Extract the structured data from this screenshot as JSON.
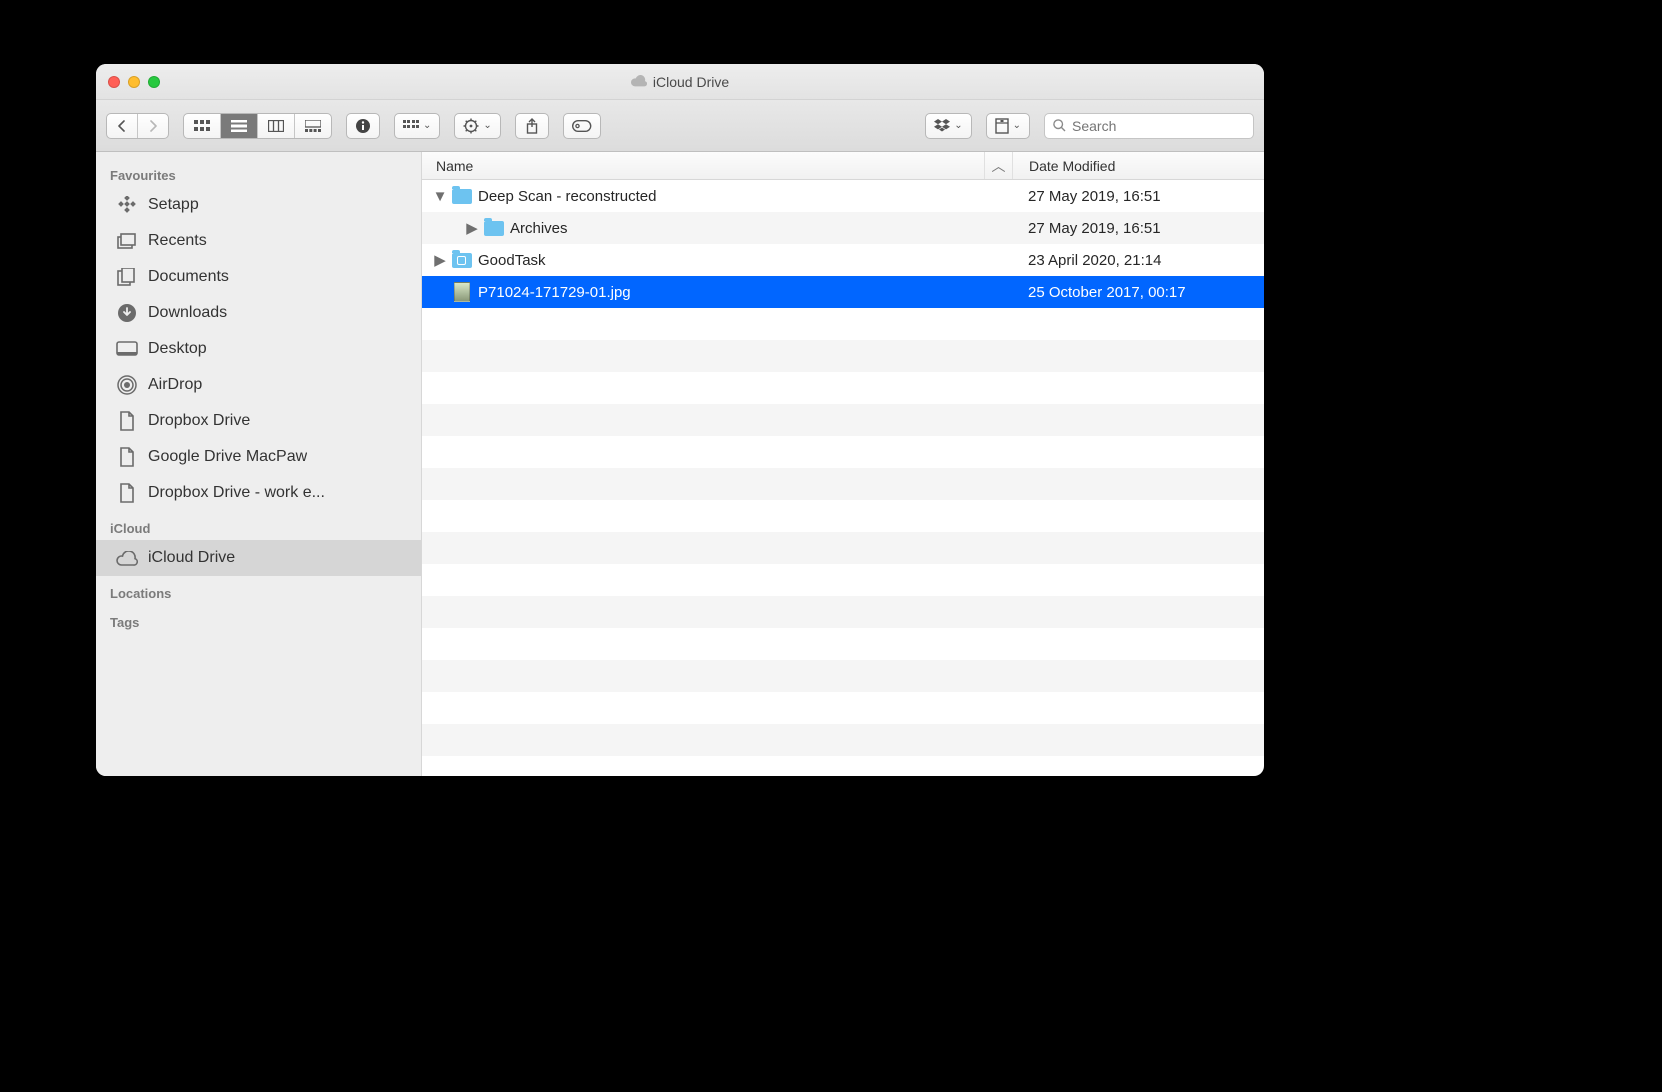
{
  "window": {
    "title": "iCloud Drive"
  },
  "toolbar": {
    "search_placeholder": "Search"
  },
  "sidebar": {
    "sections": [
      {
        "header": "Favourites",
        "items": [
          {
            "label": "Setapp",
            "icon": "setapp"
          },
          {
            "label": "Recents",
            "icon": "recents"
          },
          {
            "label": "Documents",
            "icon": "documents"
          },
          {
            "label": "Downloads",
            "icon": "downloads"
          },
          {
            "label": "Desktop",
            "icon": "desktop"
          },
          {
            "label": "AirDrop",
            "icon": "airdrop"
          },
          {
            "label": "Dropbox Drive",
            "icon": "doc"
          },
          {
            "label": "Google Drive MacPaw",
            "icon": "doc"
          },
          {
            "label": "Dropbox Drive - work e...",
            "icon": "doc"
          }
        ]
      },
      {
        "header": "iCloud",
        "items": [
          {
            "label": "iCloud Drive",
            "icon": "cloud",
            "selected": true
          }
        ]
      },
      {
        "header": "Locations",
        "items": []
      },
      {
        "header": "Tags",
        "items": []
      }
    ]
  },
  "columns": {
    "name": "Name",
    "date": "Date Modified"
  },
  "files": [
    {
      "name": "Deep Scan - reconstructed",
      "type": "folder",
      "expanded": true,
      "indent": 0,
      "date": "27 May 2019, 16:51"
    },
    {
      "name": "Archives",
      "type": "folder",
      "expanded": false,
      "indent": 1,
      "date": "27 May 2019, 16:51"
    },
    {
      "name": "GoodTask",
      "type": "app-folder",
      "expanded": false,
      "indent": 0,
      "date": "23 April 2020, 21:14"
    },
    {
      "name": "P71024-171729-01.jpg",
      "type": "jpg",
      "indent": 0,
      "date": "25 October 2017, 00:17",
      "selected": true
    }
  ]
}
